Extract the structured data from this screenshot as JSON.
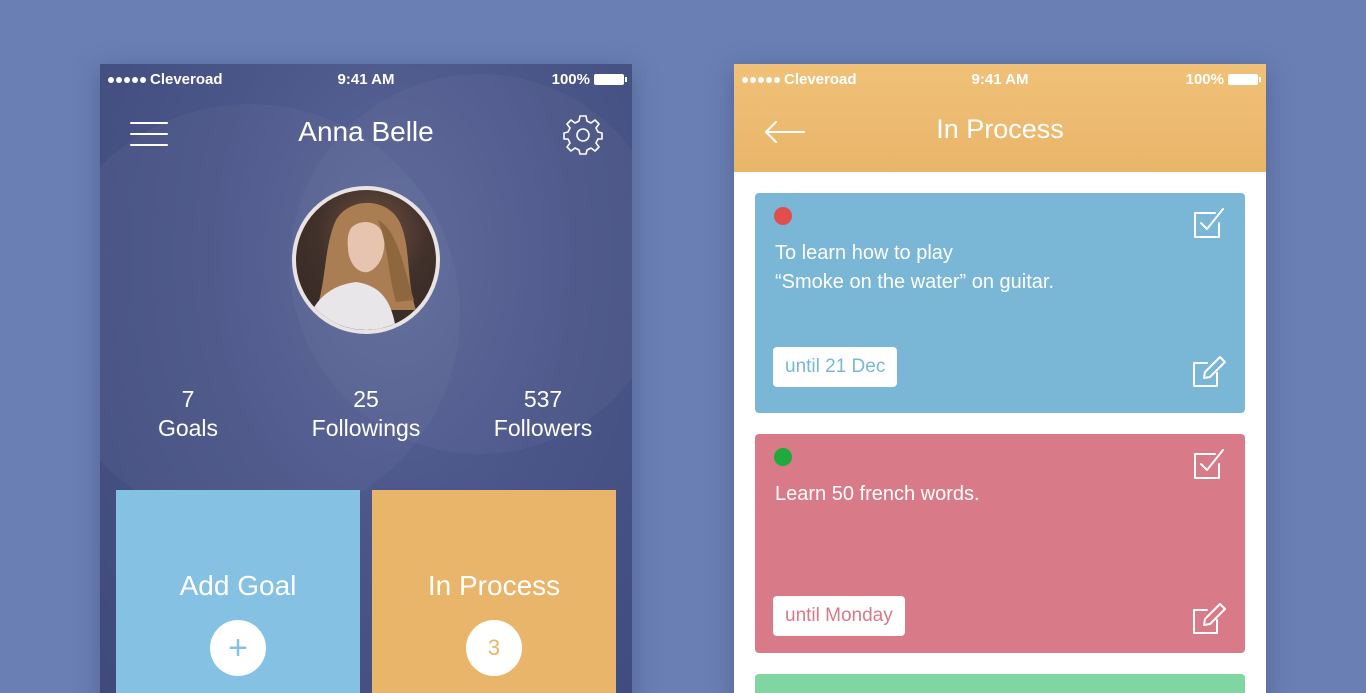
{
  "colors": {
    "background": "#6a7fb4",
    "profile_bg": "#4a5588",
    "add_goal_tile": "#85c1e3",
    "in_process_tile": "#e8b56b",
    "nav_orange": "#e9b56a",
    "card_blue": "#7ab6d6",
    "card_pink": "#d97a88",
    "card_green": "#7fd6a0",
    "dot_red": "#e24d4d",
    "dot_green": "#1eaa3c"
  },
  "profile_screen": {
    "status_bar": {
      "carrier": "Cleveroad",
      "time": "9:41 AM",
      "battery": "100%"
    },
    "menu_icon": "hamburger-menu-icon",
    "settings_icon": "gear-icon",
    "name": "Anna Belle",
    "stats": [
      {
        "value": "7",
        "label": "Goals"
      },
      {
        "value": "25",
        "label": "Followings"
      },
      {
        "value": "537",
        "label": "Followers"
      }
    ],
    "tiles": {
      "add_goal": {
        "title": "Add Goal",
        "icon": "plus-icon",
        "symbol": "+"
      },
      "in_process": {
        "title": "In Process",
        "count": "3"
      }
    }
  },
  "in_process_screen": {
    "status_bar": {
      "carrier": "Cleveroad",
      "time": "9:41 AM",
      "battery": "100%"
    },
    "back_icon": "back-arrow-icon",
    "title": "In Process",
    "cards": [
      {
        "text_line1": "To learn how to play",
        "text_line2": "“Smoke on the water” on guitar.",
        "due": "until 21 Dec",
        "status": "red"
      },
      {
        "text_line1": "Learn 50 french words.",
        "text_line2": "",
        "due": "until Monday",
        "status": "green"
      }
    ]
  }
}
